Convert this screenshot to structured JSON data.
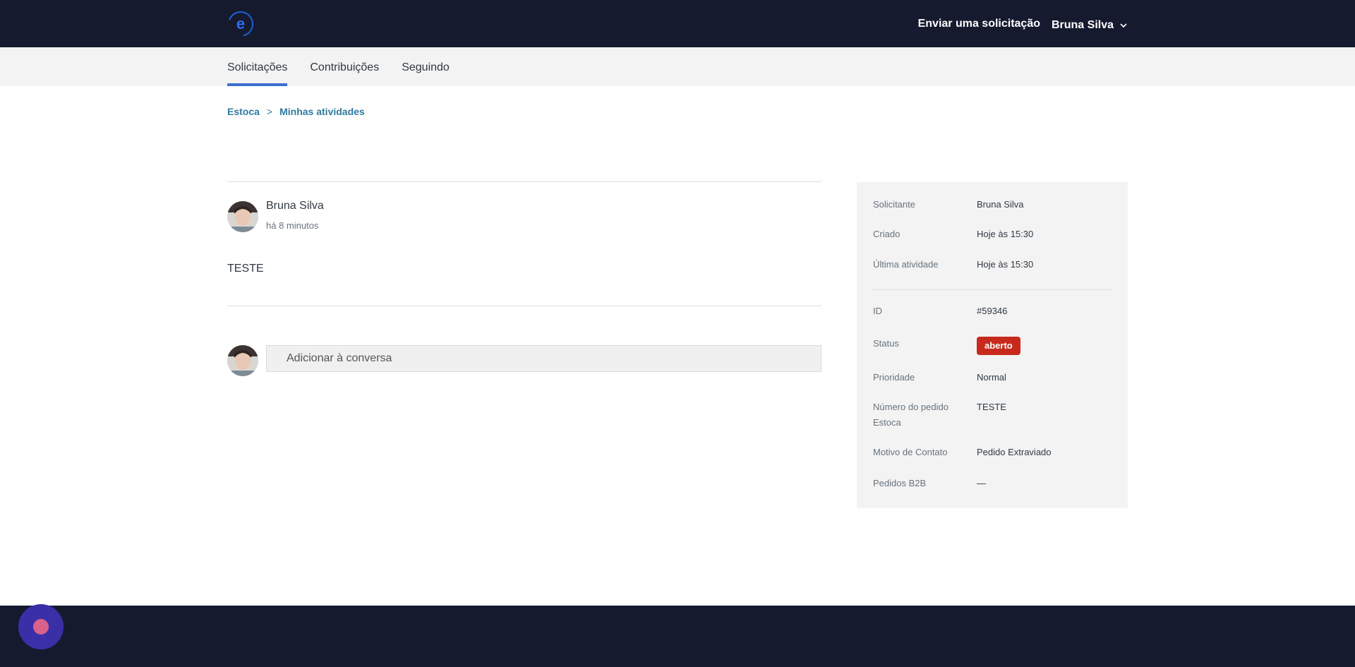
{
  "header": {
    "logo_icon": "estoca-logo-icon",
    "submit_request_label": "Enviar uma solicitação",
    "user_name": "Bruna Silva",
    "user_menu_icon": "chevron-down-icon"
  },
  "subnav": {
    "tabs": [
      {
        "label": "Solicitações",
        "active": true
      },
      {
        "label": "Contribuições",
        "active": false
      },
      {
        "label": "Seguindo",
        "active": false
      }
    ]
  },
  "breadcrumb": {
    "items": [
      "Estoca",
      "Minhas atividades"
    ],
    "separator": ">"
  },
  "comment": {
    "author": "Bruna Silva",
    "time": "há 8 minutos",
    "body": "TESTE"
  },
  "reply": {
    "placeholder": "Adicionar à conversa"
  },
  "details": {
    "requester_label": "Solicitante",
    "requester_value": "Bruna Silva",
    "created_label": "Criado",
    "created_value": "Hoje às 15:30",
    "last_activity_label": "Última atividade",
    "last_activity_value": "Hoje às 15:30",
    "id_label": "ID",
    "id_value": "#59346",
    "status_label": "Status",
    "status_value": "aberto",
    "priority_label": "Prioridade",
    "priority_value": "Normal",
    "order_number_label": "Número do pedido Estoca",
    "order_number_value": "TESTE",
    "contact_reason_label": "Motivo de Contato",
    "contact_reason_value": "Pedido Extraviado",
    "b2b_orders_label": "Pedidos B2B",
    "b2b_orders_value": "—"
  },
  "colors": {
    "header_bg": "#161a2f",
    "accent": "#3b6fcf",
    "link": "#2f7aa0",
    "status_open": "#c72a1c",
    "chat_launcher": "#3b2fa8"
  }
}
